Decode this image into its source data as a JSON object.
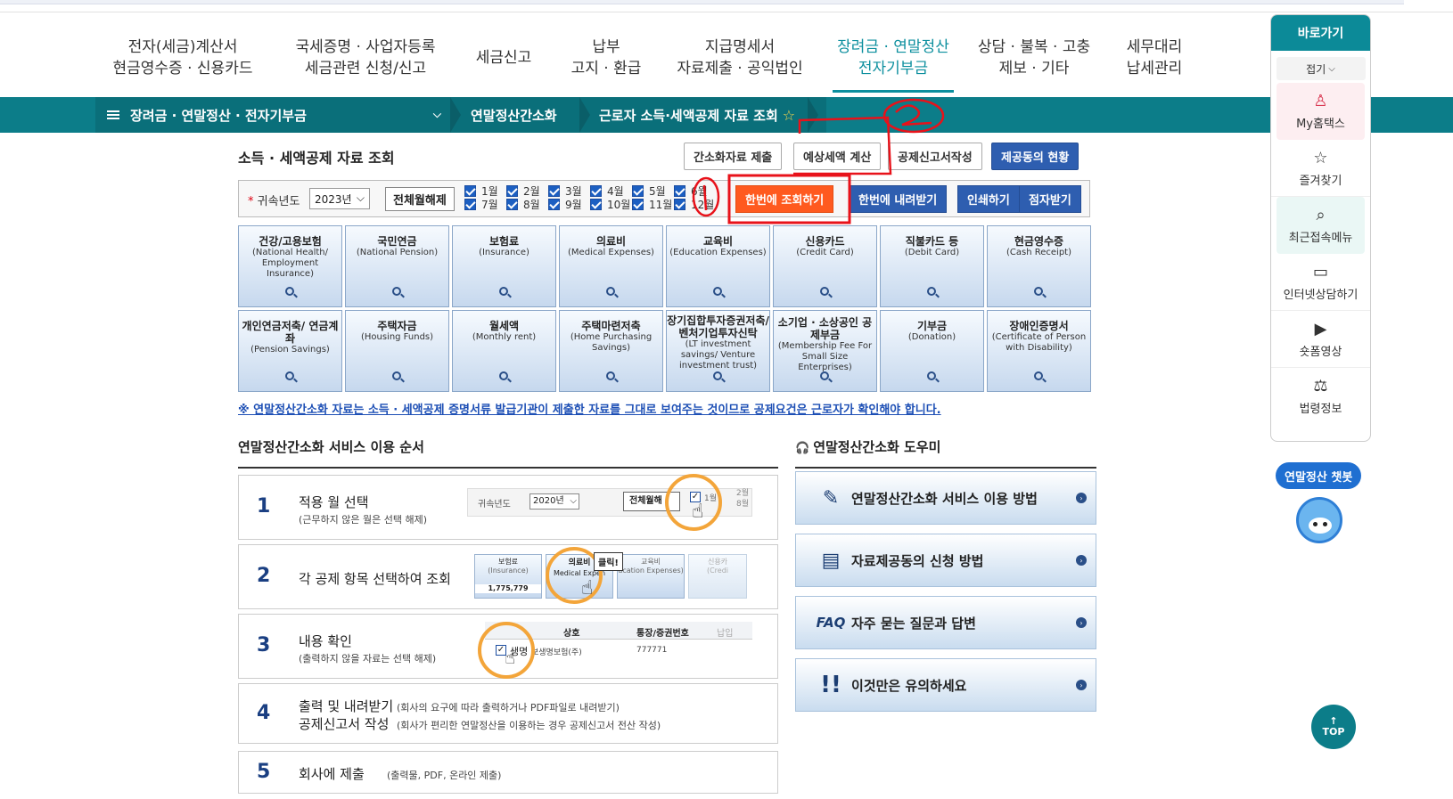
{
  "gnb": [
    {
      "l1": "전자(세금)계산서",
      "l2": "현금영수증 · 신용카드",
      "active": false
    },
    {
      "l1": "국세증명 · 사업자등록",
      "l2": "세금관련 신청/신고",
      "active": false
    },
    {
      "l1": "세금신고",
      "l2": "",
      "active": false
    },
    {
      "l1": "납부",
      "l2": "고지 · 환급",
      "active": false
    },
    {
      "l1": "지급명세서",
      "l2": "자료제출 · 공익법인",
      "active": false
    },
    {
      "l1": "장려금 · 연말정산",
      "l2": "전자기부금",
      "active": true
    },
    {
      "l1": "상담 · 불복 · 고충",
      "l2": "제보 · 기타",
      "active": false
    },
    {
      "l1": "세무대리",
      "l2": "납세관리",
      "active": false
    }
  ],
  "lnb": {
    "main": "장려금 · 연말정산 · 전자기부금",
    "sub1": "연말정산간소화",
    "sub2": "근로자 소득·세액공제 자료 조회"
  },
  "page": {
    "title": "소득 · 세액공제 자료 조회"
  },
  "top_buttons": {
    "b1": "간소화자료 제출",
    "b2": "예상세액 계산",
    "b3": "공제신고서작성",
    "b4": "제공동의 현황"
  },
  "filter": {
    "label": "귀속년도",
    "year": "2023년",
    "release": "전체월해제",
    "months": [
      "1월",
      "2월",
      "3월",
      "4월",
      "5월",
      "6월",
      "7월",
      "8월",
      "9월",
      "10월",
      "11월",
      "12월"
    ],
    "btn_query": "한번에 조회하기",
    "btn_download": "한번에 내려받기",
    "btn_print": "인쇄하기",
    "btn_braille": "점자받기"
  },
  "categories": [
    {
      "k": "건강/고용보험",
      "e": "(National Health/ Employment Insurance)"
    },
    {
      "k": "국민연금",
      "e": "(National Pension)"
    },
    {
      "k": "보험료",
      "e": "(Insurance)"
    },
    {
      "k": "의료비",
      "e": "(Medical Expenses)"
    },
    {
      "k": "교육비",
      "e": "(Education Expenses)"
    },
    {
      "k": "신용카드",
      "e": "(Credit Card)"
    },
    {
      "k": "직불카드 등",
      "e": "(Debit Card)"
    },
    {
      "k": "현금영수증",
      "e": "(Cash Receipt)"
    },
    {
      "k": "개인연금저축/ 연금계좌",
      "e": "(Pension Savings)"
    },
    {
      "k": "주택자금",
      "e": "(Housing Funds)"
    },
    {
      "k": "월세액",
      "e": "(Monthly rent)"
    },
    {
      "k": "주택마련저축",
      "e": "(Home Purchasing Savings)"
    },
    {
      "k": "장기집합투자증권저축/ 벤처기업투자신탁",
      "e": "(LT investment savings/ Venture investment trust)"
    },
    {
      "k": "소기업 · 소상공인 공제부금",
      "e": "(Membership Fee For Small Size Enterprises)"
    },
    {
      "k": "기부금",
      "e": "(Donation)"
    },
    {
      "k": "장애인증명서",
      "e": "(Certificate of Person with Disability)"
    }
  ],
  "notice": "※ 연말정산간소화 자료는 소득 · 세액공제 증명서류 발급기관이 제출한 자료를 그대로 보여주는 것이므로 공제요건은 근로자가 확인해야 합니다.",
  "steps_title": "연말정산간소화 서비스 이용 순서",
  "steps": [
    {
      "n": "1",
      "t": "적용 월 선택",
      "d": "(근무하지 않은 월은 선택 해제)"
    },
    {
      "n": "2",
      "t": "각 공제 항목 선택하여 조회",
      "d": ""
    },
    {
      "n": "3",
      "t": "내용 확인",
      "d": "(출력하지 않을 자료는 선택 해제)"
    },
    {
      "n": "4",
      "t": "출력 및 내려받기",
      "d": "(회사의 요구에 따라 출력하거나 PDF파일로 내려받기)",
      "t2": "공제신고서 작성",
      "d2": "(회사가 편리한 연말정산을 이용하는 경우 공제신고서 전산 작성)"
    },
    {
      "n": "5",
      "t": "회사에 제출",
      "d": "(출력물, PDF, 온라인 제출)"
    }
  ],
  "illu": {
    "s1": {
      "label": "귀속년도",
      "year": "2020년",
      "release": "전체월해",
      "m1": "1월",
      "m2": "2월",
      "m3": "8월"
    },
    "s2": {
      "c1": "보험료",
      "c1e": "(Insurance)",
      "amount": "1,775,779",
      "c2": "의료비",
      "c2e": "Medical Expen",
      "click": "클릭!",
      "c3": "교육비",
      "c3e": "ucation Expenses)",
      "c4": "신용카",
      "c4e": "(Credi"
    },
    "s3": {
      "col1": "상호",
      "col2": "통장/증권번호",
      "col3": "납입",
      "row1a": "생명",
      "row1b": "보생명보험(주)",
      "row1c": "777771"
    }
  },
  "helper_title": "연말정산간소화 도우미",
  "helpers": [
    {
      "icon": "document-edit-icon",
      "label": "연말정산간소화 서비스 이용 방법"
    },
    {
      "icon": "document-icon",
      "label": "자료제공동의 신청 방법"
    },
    {
      "icon": "faq-icon",
      "label": "자주 묻는 질문과 답변",
      "badge": "FAQ"
    },
    {
      "icon": "exclamation-icon",
      "label": "이것만은 유의하세요"
    }
  ],
  "quick": {
    "title": "바로가기",
    "fold": "접기",
    "items": [
      "My홈택스",
      "즐겨찾기",
      "최근접속메뉴",
      "인터넷상담하기",
      "숏폼영상",
      "법령정보"
    ]
  },
  "chatbot": "연말정산 챗봇",
  "top": "TOP",
  "colors": {
    "teal": "#0c7d89",
    "orange": "#ff5a1f",
    "blue": "#2e5eb0",
    "annotation": "#e8121a"
  }
}
